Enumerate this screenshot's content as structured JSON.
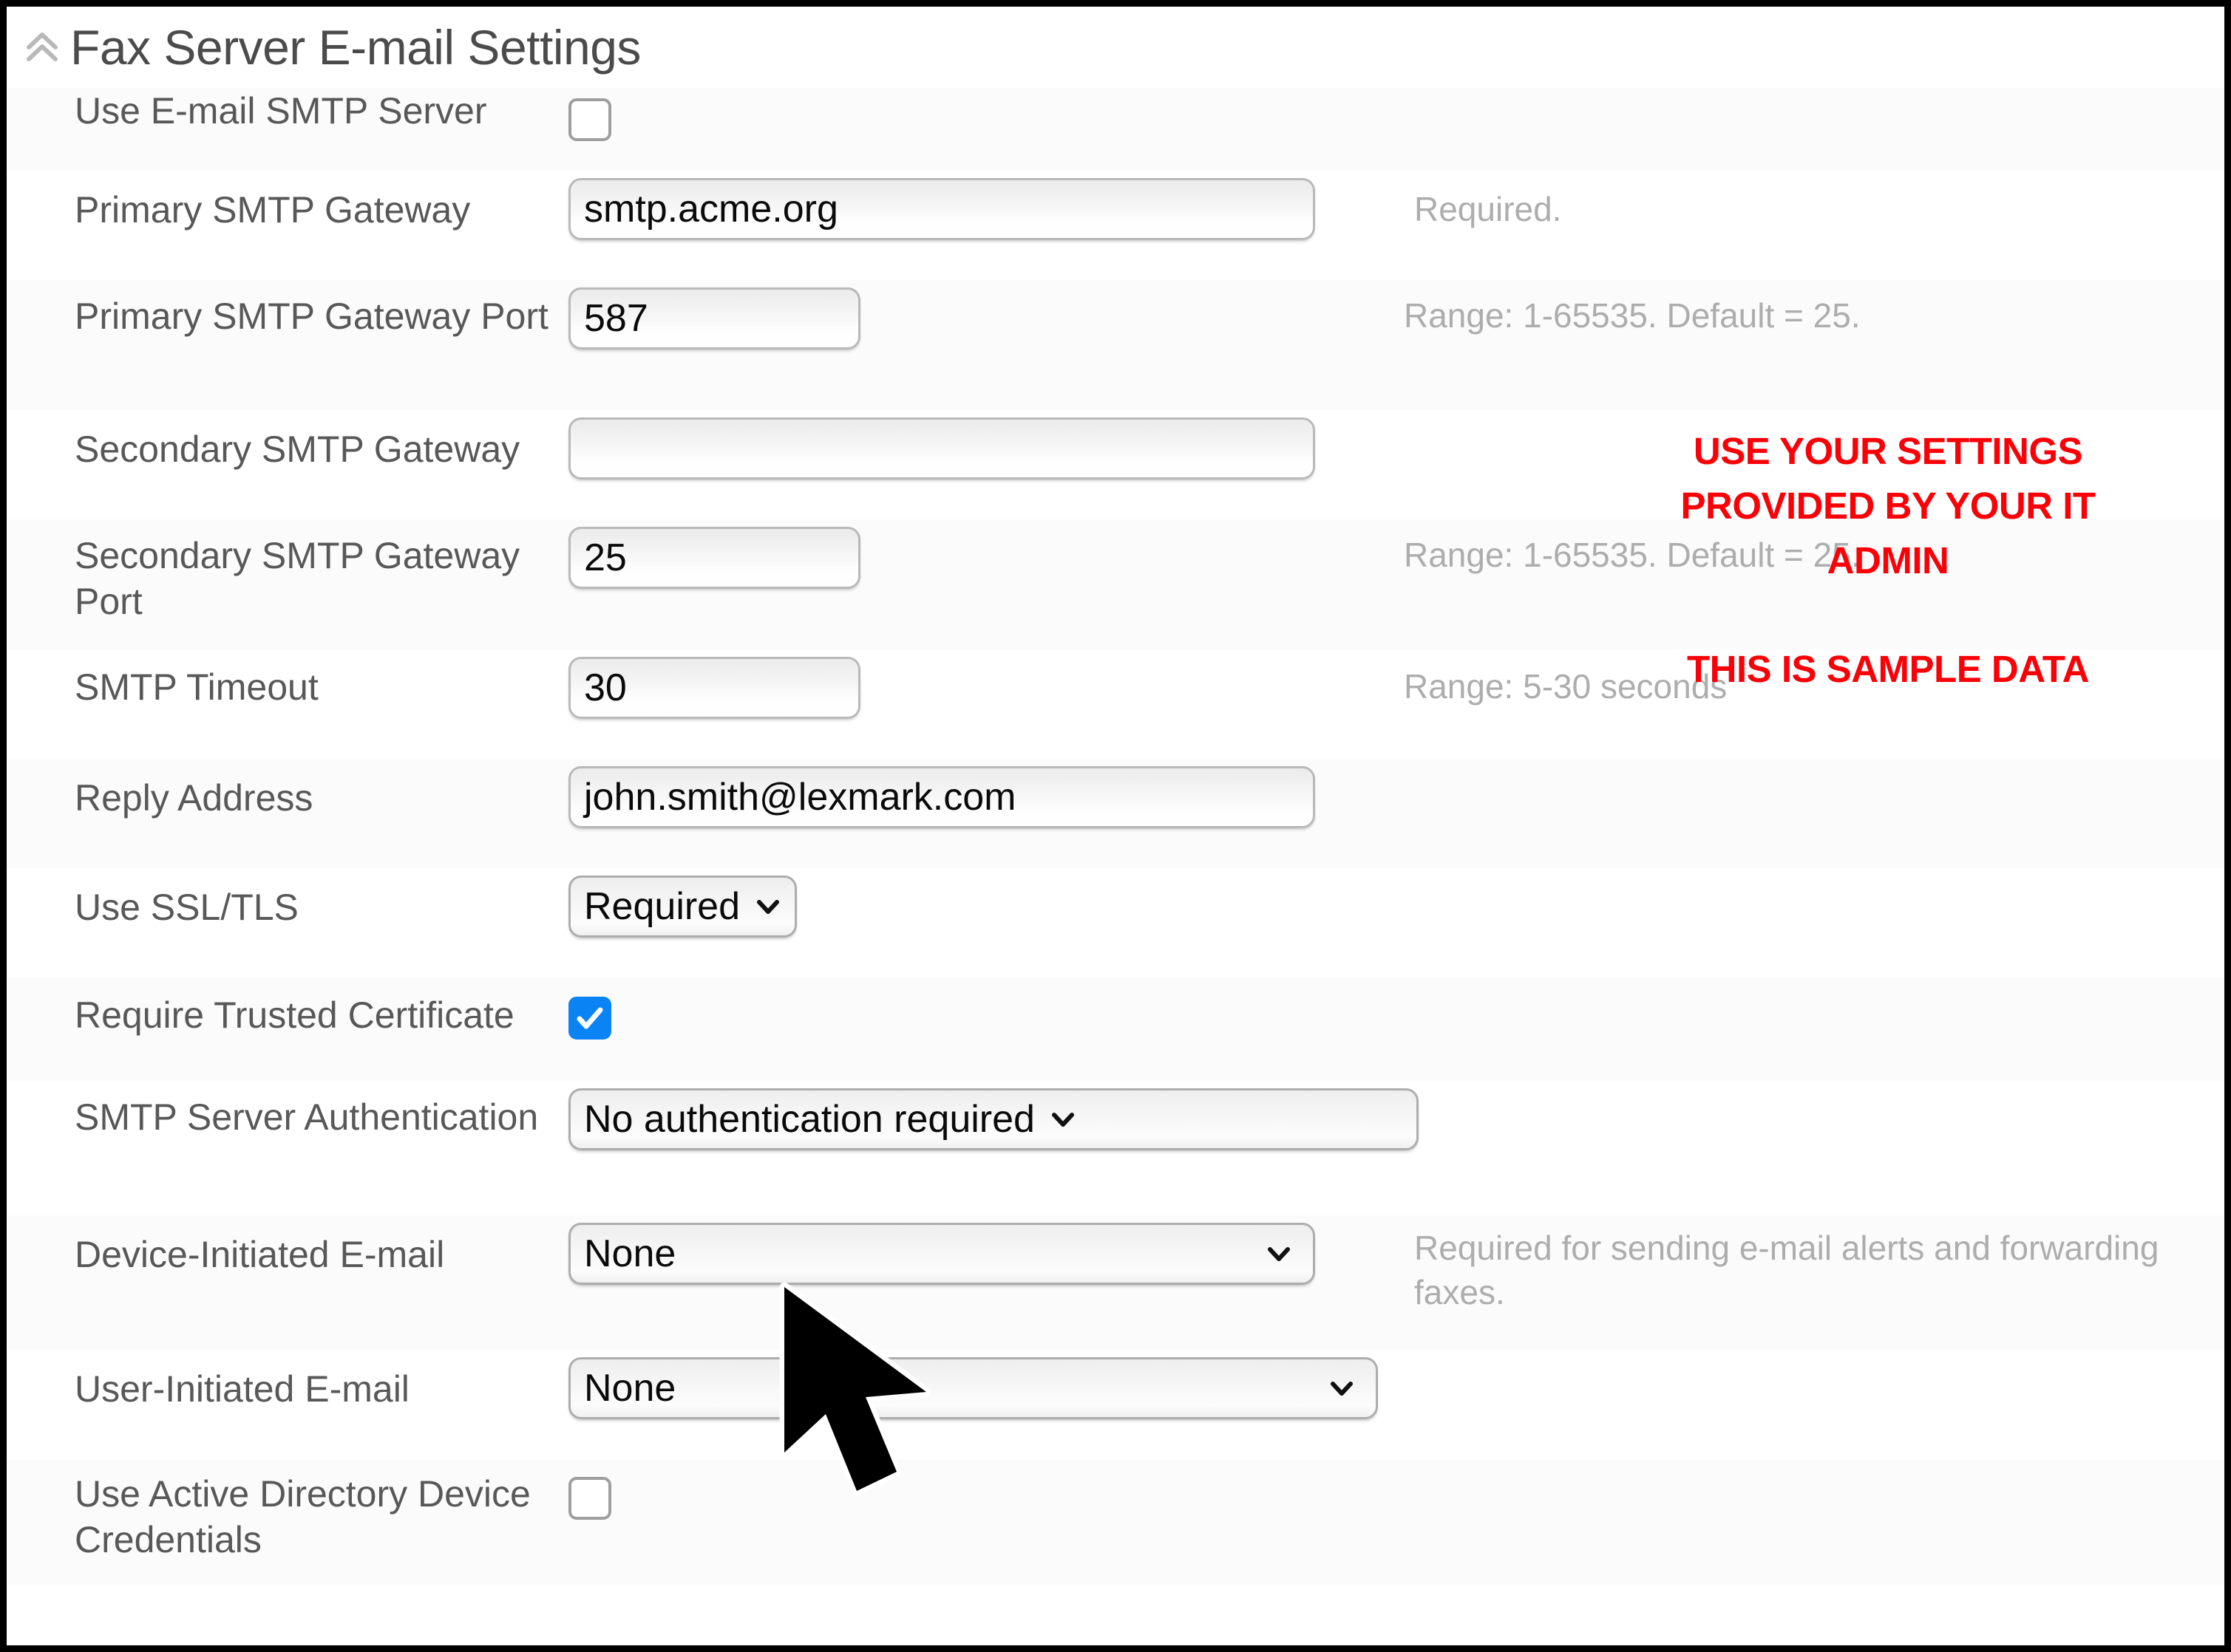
{
  "header": {
    "title": "Fax Server E-mail Settings",
    "collapse_icon": "chevron-double-up-icon"
  },
  "form": {
    "rows": [
      {
        "label": "Use E-mail SMTP Server",
        "control": "checkbox",
        "checked": false,
        "hint": ""
      },
      {
        "label": "Primary SMTP Gateway",
        "control": "text",
        "value": "smtp.acme.org",
        "hint": "Required."
      },
      {
        "label": "Primary SMTP Gateway Port",
        "control": "text-small",
        "value": "587",
        "hint": "Range: 1-65535. Default = 25."
      },
      {
        "label": "Secondary SMTP Gateway",
        "control": "text",
        "value": "",
        "hint": ""
      },
      {
        "label": "Secondary SMTP Gateway Port",
        "control": "text-small",
        "value": "25",
        "hint": "Range: 1-65535. Default = 25."
      },
      {
        "label": "SMTP Timeout",
        "control": "text-small",
        "value": "30",
        "hint": "Range: 5-30 seconds"
      },
      {
        "label": "Reply Address",
        "control": "text",
        "value": "john.smith@lexmark.com",
        "hint": ""
      },
      {
        "label": "Use SSL/TLS",
        "control": "select-auto",
        "value": "Required",
        "hint": ""
      },
      {
        "label": "Require Trusted Certificate",
        "control": "checkbox",
        "checked": true,
        "hint": ""
      },
      {
        "label": "SMTP Server Authentication",
        "control": "select-xwide",
        "value": "No authentication required",
        "hint": ""
      },
      {
        "label": "Device-Initiated E-mail",
        "control": "select-wide",
        "value": "None",
        "hint": "Required for sending e-mail alerts and forwarding faxes."
      },
      {
        "label": "User-Initiated E-mail",
        "control": "select-wide",
        "value": "None",
        "hint": ""
      },
      {
        "label": "Use Active Directory Device Credentials",
        "control": "checkbox",
        "checked": false,
        "hint": ""
      }
    ]
  },
  "annotation": {
    "main": "USE YOUR SETTINGS PROVIDED BY YOUR IT ADMIN",
    "sub": "THIS IS SAMPLE DATA",
    "color": "#FB0007"
  },
  "cursor": {
    "icon": "mouse-pointer-icon"
  },
  "colors": {
    "label": "#585858",
    "hint": "#ADADAD",
    "value": "#0A0A0A",
    "checkbox_checked": "#0A84F5",
    "annotation": "#FB0007"
  }
}
